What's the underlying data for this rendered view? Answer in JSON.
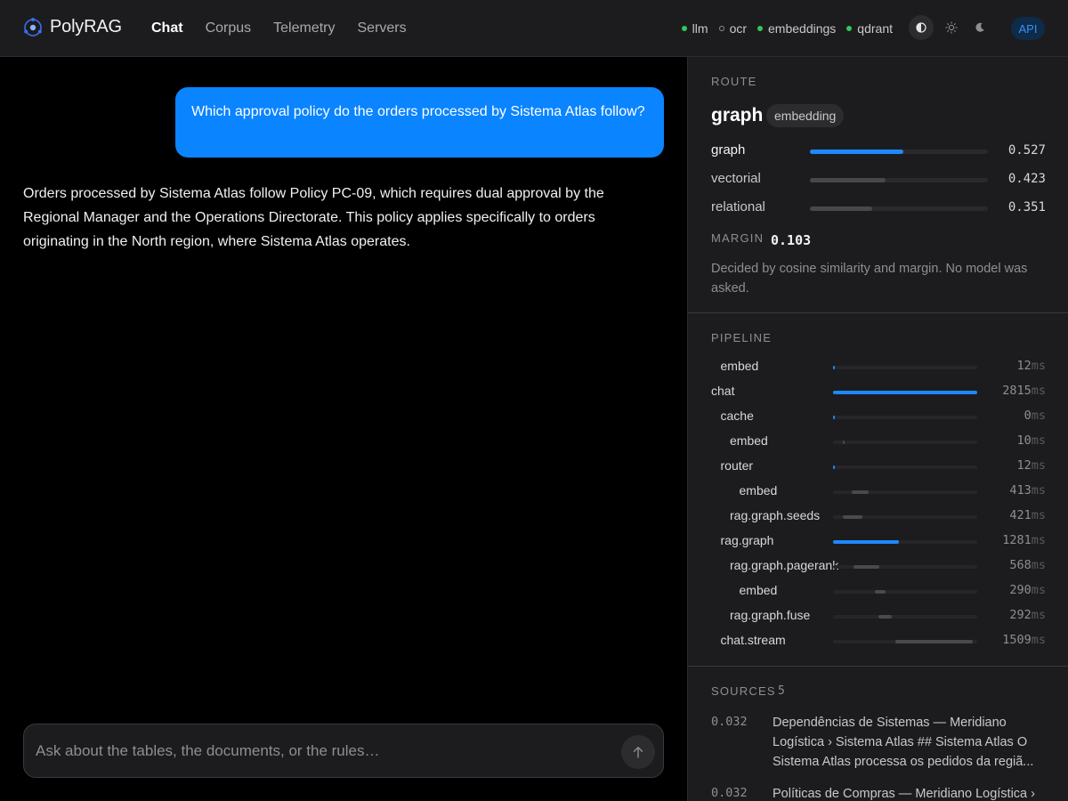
{
  "app": {
    "brand": "PolyRAG",
    "nav": [
      {
        "label": "Chat",
        "active": true
      },
      {
        "label": "Corpus",
        "active": false
      },
      {
        "label": "Telemetry",
        "active": false
      },
      {
        "label": "Servers",
        "active": false
      }
    ],
    "services": [
      {
        "label": "llm",
        "status": "up"
      },
      {
        "label": "ocr",
        "status": "down"
      },
      {
        "label": "embeddings",
        "status": "up"
      },
      {
        "label": "qdrant",
        "status": "up"
      }
    ],
    "theme_icons": [
      "contrast-icon",
      "sun-icon",
      "moon-icon"
    ],
    "api_label": "API"
  },
  "chat": {
    "question": "Which approval policy do the orders processed by Sistema Atlas follow?",
    "answer": "Orders processed by Sistema Atlas follow Policy PC-09, which requires dual approval by the Regional Manager and the Operations Directorate. This policy applies specifically to orders originating in the North region, where Sistema Atlas operates.",
    "input_placeholder": "Ask about the tables, the documents, or the rules…"
  },
  "route": {
    "section_title": "ROUTE",
    "name": "graph",
    "badge": "embedding",
    "scores": [
      {
        "label": "graph",
        "value": "0.527",
        "fraction": 0.527,
        "lead": true
      },
      {
        "label": "vectorial",
        "value": "0.423",
        "fraction": 0.423,
        "lead": false
      },
      {
        "label": "relational",
        "value": "0.351",
        "fraction": 0.351,
        "lead": false
      }
    ],
    "margin_label": "MARGIN",
    "margin_value": "0.103",
    "note": "Decided by cosine similarity and margin. No model was asked."
  },
  "pipeline": {
    "section_title": "PIPELINE",
    "spans": [
      {
        "label": "embed",
        "depth": 1,
        "ms": "12",
        "start": 0,
        "dur": 12
      },
      {
        "label": "chat",
        "depth": 0,
        "ms": "2815",
        "start": 0,
        "dur": 2815
      },
      {
        "label": "cache",
        "depth": 1,
        "ms": "0",
        "start": 0,
        "dur": 0
      },
      {
        "label": "embed",
        "depth": 2,
        "ms": "10",
        "start": 190,
        "dur": 10
      },
      {
        "label": "router",
        "depth": 1,
        "ms": "12",
        "start": 0,
        "dur": 12
      },
      {
        "label": "embed",
        "depth": 3,
        "ms": "413",
        "start": 370,
        "dur": 330
      },
      {
        "label": "rag.graph.seeds",
        "depth": 2,
        "ms": "421",
        "start": 190,
        "dur": 380
      },
      {
        "label": "rag.graph",
        "depth": 1,
        "ms": "1281",
        "start": 0,
        "dur": 1281
      },
      {
        "label": "rag.graph.pagerank",
        "depth": 2,
        "ms": "568",
        "start": 400,
        "dur": 500
      },
      {
        "label": "embed",
        "depth": 3,
        "ms": "290",
        "start": 810,
        "dur": 220
      },
      {
        "label": "rag.graph.fuse",
        "depth": 2,
        "ms": "292",
        "start": 890,
        "dur": 260
      },
      {
        "label": "chat.stream",
        "depth": 1,
        "ms": "1509",
        "start": 1220,
        "dur": 1509
      }
    ],
    "unit": "ms"
  },
  "sources": {
    "section_title": "SOURCES",
    "count": "5",
    "items": [
      {
        "score": "0.032",
        "text": "Dependências de Sistemas — Meridiano Logística › Sistema Atlas ## Sistema Atlas O Sistema Atlas processa os pedidos da regiã..."
      },
      {
        "score": "0.032",
        "text": "Políticas de Compras — Meridiano Logística ›"
      }
    ]
  }
}
